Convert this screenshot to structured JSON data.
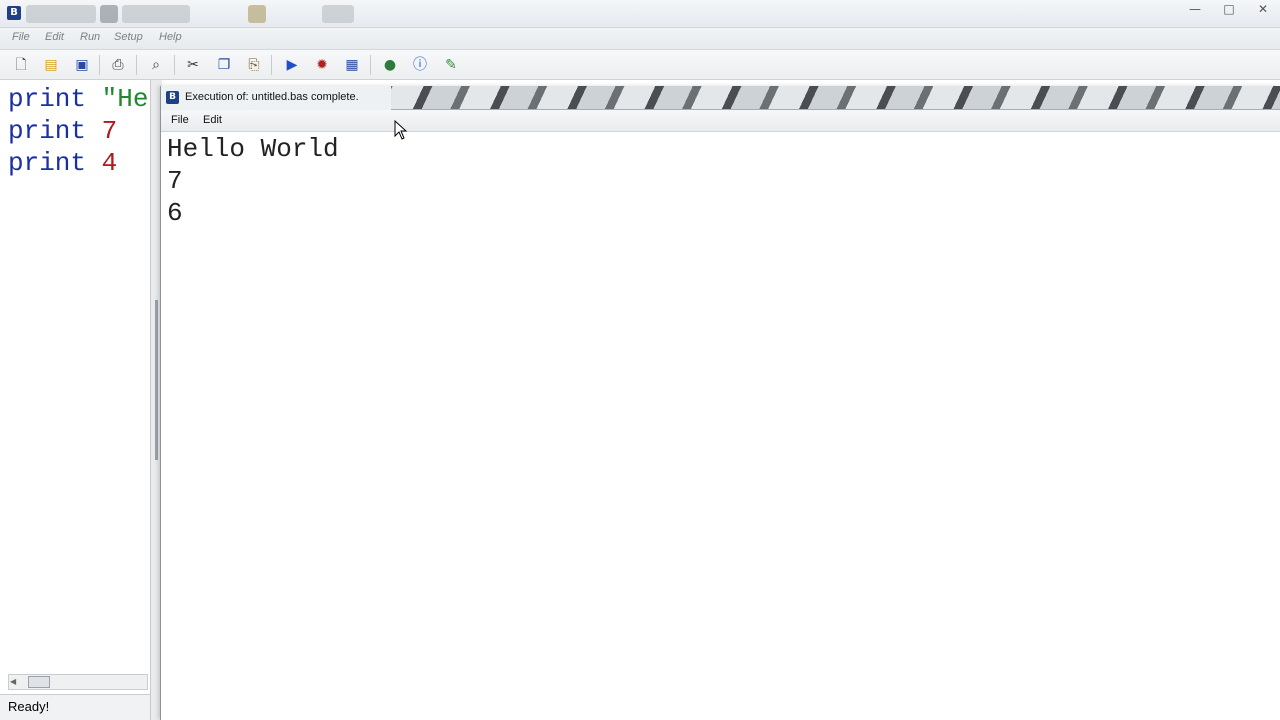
{
  "ide": {
    "menus": [
      "File",
      "Edit",
      "Run",
      "Setup",
      "Help"
    ],
    "editor_lines": [
      {
        "keyword": "print",
        "arg": "\"He",
        "arg_type": "string"
      },
      {
        "keyword": "print",
        "arg": "7",
        "arg_type": "number"
      },
      {
        "keyword": "print",
        "arg": "4",
        "arg_type": "number"
      }
    ],
    "status": "Ready!"
  },
  "toolbar": {
    "icons": [
      "new-file-icon",
      "open-folder-icon",
      "save-icon",
      "print-icon",
      "find-icon",
      "cut-icon",
      "copy-icon",
      "paste-icon",
      "run-icon",
      "debug-icon",
      "binary-icon",
      "web-icon",
      "help-icon",
      "edit-icon"
    ]
  },
  "output_window": {
    "title": "Execution of: untitled.bas complete.",
    "menus": [
      "File",
      "Edit"
    ],
    "lines": [
      "Hello World",
      "7",
      "6"
    ]
  },
  "window_controls": {
    "minimize": "—",
    "maximize": "□",
    "close": "✕"
  },
  "colors": {
    "keyword": "#1a2fa8",
    "string": "#1d8a2b",
    "number": "#b01a1a",
    "logo": "#1f3f88"
  }
}
